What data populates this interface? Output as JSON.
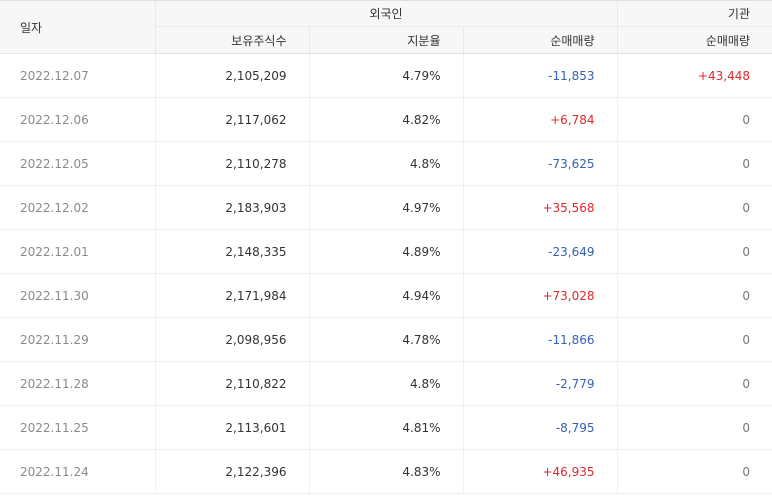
{
  "header": {
    "date_label": "일자",
    "foreign_label": "외국인",
    "institution_label": "기관",
    "holdings_label": "보유주식수",
    "ratio_label": "지분율",
    "foreign_net_label": "순매매량",
    "inst_net_label": "순매매량"
  },
  "rows": [
    {
      "date": "2022.12.07",
      "holdings": "2,105,209",
      "ratio": "4.79%",
      "foreign_net": "-11,853",
      "inst_net": "+43,448"
    },
    {
      "date": "2022.12.06",
      "holdings": "2,117,062",
      "ratio": "4.82%",
      "foreign_net": "+6,784",
      "inst_net": "0"
    },
    {
      "date": "2022.12.05",
      "holdings": "2,110,278",
      "ratio": "4.8%",
      "foreign_net": "-73,625",
      "inst_net": "0"
    },
    {
      "date": "2022.12.02",
      "holdings": "2,183,903",
      "ratio": "4.97%",
      "foreign_net": "+35,568",
      "inst_net": "0"
    },
    {
      "date": "2022.12.01",
      "holdings": "2,148,335",
      "ratio": "4.89%",
      "foreign_net": "-23,649",
      "inst_net": "0"
    },
    {
      "date": "2022.11.30",
      "holdings": "2,171,984",
      "ratio": "4.94%",
      "foreign_net": "+73,028",
      "inst_net": "0"
    },
    {
      "date": "2022.11.29",
      "holdings": "2,098,956",
      "ratio": "4.78%",
      "foreign_net": "-11,866",
      "inst_net": "0"
    },
    {
      "date": "2022.11.28",
      "holdings": "2,110,822",
      "ratio": "4.8%",
      "foreign_net": "-2,779",
      "inst_net": "0"
    },
    {
      "date": "2022.11.25",
      "holdings": "2,113,601",
      "ratio": "4.81%",
      "foreign_net": "-8,795",
      "inst_net": "0"
    },
    {
      "date": "2022.11.24",
      "holdings": "2,122,396",
      "ratio": "4.83%",
      "foreign_net": "+46,935",
      "inst_net": "0"
    }
  ],
  "colors": {
    "positive": "#e0282e",
    "negative": "#3660b6",
    "zero": "#777777",
    "header_bg": "#f7f7f7"
  }
}
